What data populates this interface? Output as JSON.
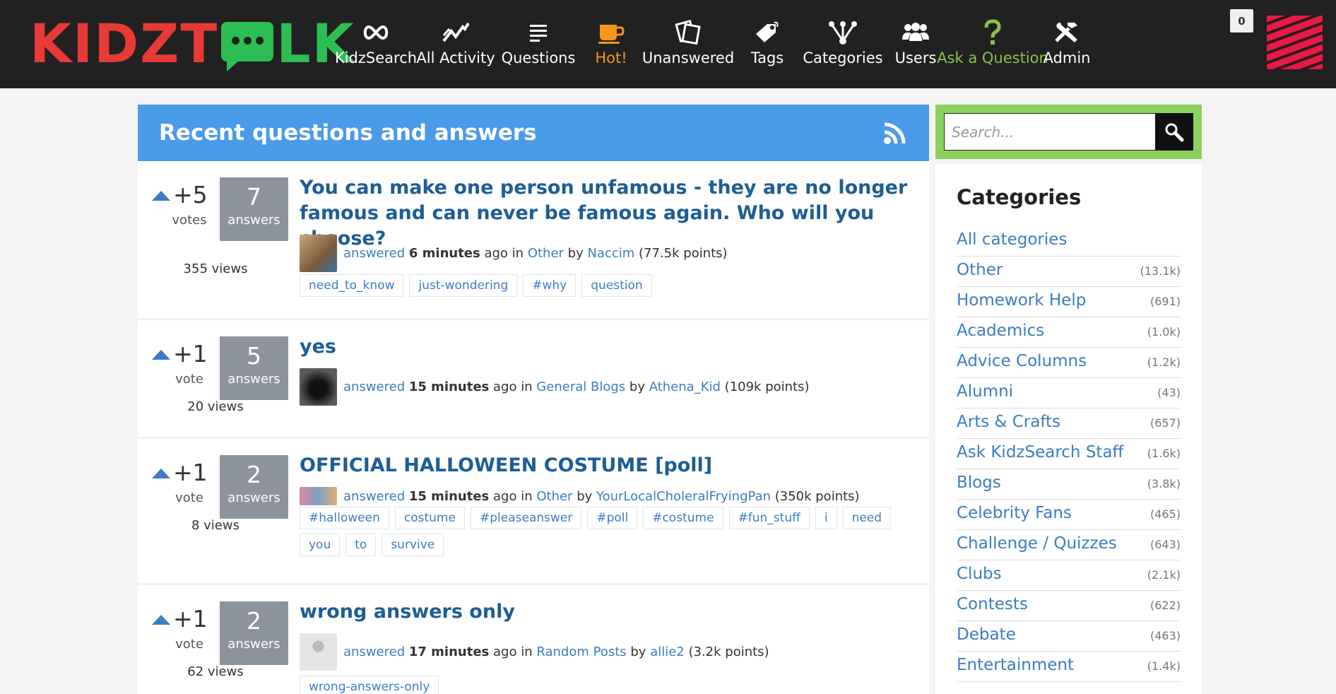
{
  "brand": {
    "logo_left": "KIDZT",
    "logo_right": "LK"
  },
  "nav": [
    {
      "label": "KidzSearch",
      "icon": "infinity-icon"
    },
    {
      "label": "All Activity",
      "icon": "activity-chart-icon"
    },
    {
      "label": "Questions",
      "icon": "list-lines-icon"
    },
    {
      "label": "Hot!",
      "icon": "coffee-cup-icon"
    },
    {
      "label": "Unanswered",
      "icon": "cards-icon"
    },
    {
      "label": "Tags",
      "icon": "tag-icon"
    },
    {
      "label": "Categories",
      "icon": "hierarchy-icon"
    },
    {
      "label": "Users",
      "icon": "users-icon"
    },
    {
      "label": "Ask a Question",
      "icon": "question-mark-icon"
    },
    {
      "label": "Admin",
      "icon": "tools-icon"
    }
  ],
  "colors": {
    "nav_hot": "#f7941d",
    "nav_ask": "#8bc34a",
    "header_blue": "#4a9be8",
    "link_blue": "#3d7cc4",
    "title_blue": "#1d5d96",
    "search_green": "#8bd15e"
  },
  "notifications": {
    "count": "0"
  },
  "main": {
    "title": "Recent questions and answers",
    "rss_icon": "rss-icon"
  },
  "questions": [
    {
      "netvote": "+5",
      "vote_label": "votes",
      "answers": "7",
      "answers_label": "answers",
      "views": "355 views",
      "title": "You can make one person unfamous - they are no longer famous and can never be famous again. Who will you choose?",
      "action": "answered",
      "when": "6 minutes",
      "ago": "ago in",
      "category": "Other",
      "by": "by",
      "user": "Naccim",
      "points": "(77.5k points)",
      "tags": [
        "need_to_know",
        "just-wondering",
        "#why",
        "question"
      ]
    },
    {
      "netvote": "+1",
      "vote_label": "vote",
      "answers": "5",
      "answers_label": "answers",
      "views": "20 views",
      "title": "yes",
      "action": "answered",
      "when": "15 minutes",
      "ago": "ago in",
      "category": "General Blogs",
      "by": "by",
      "user": "Athena_Kid",
      "points": "(109k points)",
      "tags": []
    },
    {
      "netvote": "+1",
      "vote_label": "vote",
      "answers": "2",
      "answers_label": "answers",
      "views": "8 views",
      "title": "OFFICIAL HALLOWEEN COSTUME [poll]",
      "action": "answered",
      "when": "15 minutes",
      "ago": "ago in",
      "category": "Other",
      "by": "by",
      "user": "YourLocalCholeralFryingPan",
      "points": "(350k points)",
      "tags": [
        "#halloween",
        "costume",
        "#pleaseanswer",
        "#poll",
        "#costume",
        "#fun_stuff",
        "i",
        "need",
        "you",
        "to",
        "survive"
      ]
    },
    {
      "netvote": "+1",
      "vote_label": "vote",
      "answers": "2",
      "answers_label": "answers",
      "views": "62 views",
      "title": "wrong answers only",
      "action": "answered",
      "when": "17 minutes",
      "ago": "ago in",
      "category": "Random Posts",
      "by": "by",
      "user": "allie2",
      "points": "(3.2k points)",
      "tags": [
        "wrong-answers-only"
      ]
    }
  ],
  "search": {
    "placeholder": "Search..."
  },
  "categories": {
    "heading": "Categories",
    "items": [
      {
        "name": "All categories",
        "count": ""
      },
      {
        "name": "Other",
        "count": "(13.1k)"
      },
      {
        "name": "Homework Help",
        "count": "(691)"
      },
      {
        "name": "Academics",
        "count": "(1.0k)"
      },
      {
        "name": "Advice Columns",
        "count": "(1.2k)"
      },
      {
        "name": "Alumni",
        "count": "(43)"
      },
      {
        "name": "Arts & Crafts",
        "count": "(657)"
      },
      {
        "name": "Ask KidzSearch Staff",
        "count": "(1.6k)"
      },
      {
        "name": "Blogs",
        "count": "(3.8k)"
      },
      {
        "name": "Celebrity Fans",
        "count": "(465)"
      },
      {
        "name": "Challenge / Quizzes",
        "count": "(643)"
      },
      {
        "name": "Clubs",
        "count": "(2.1k)"
      },
      {
        "name": "Contests",
        "count": "(622)"
      },
      {
        "name": "Debate",
        "count": "(463)"
      },
      {
        "name": "Entertainment",
        "count": "(1.4k)"
      }
    ]
  }
}
